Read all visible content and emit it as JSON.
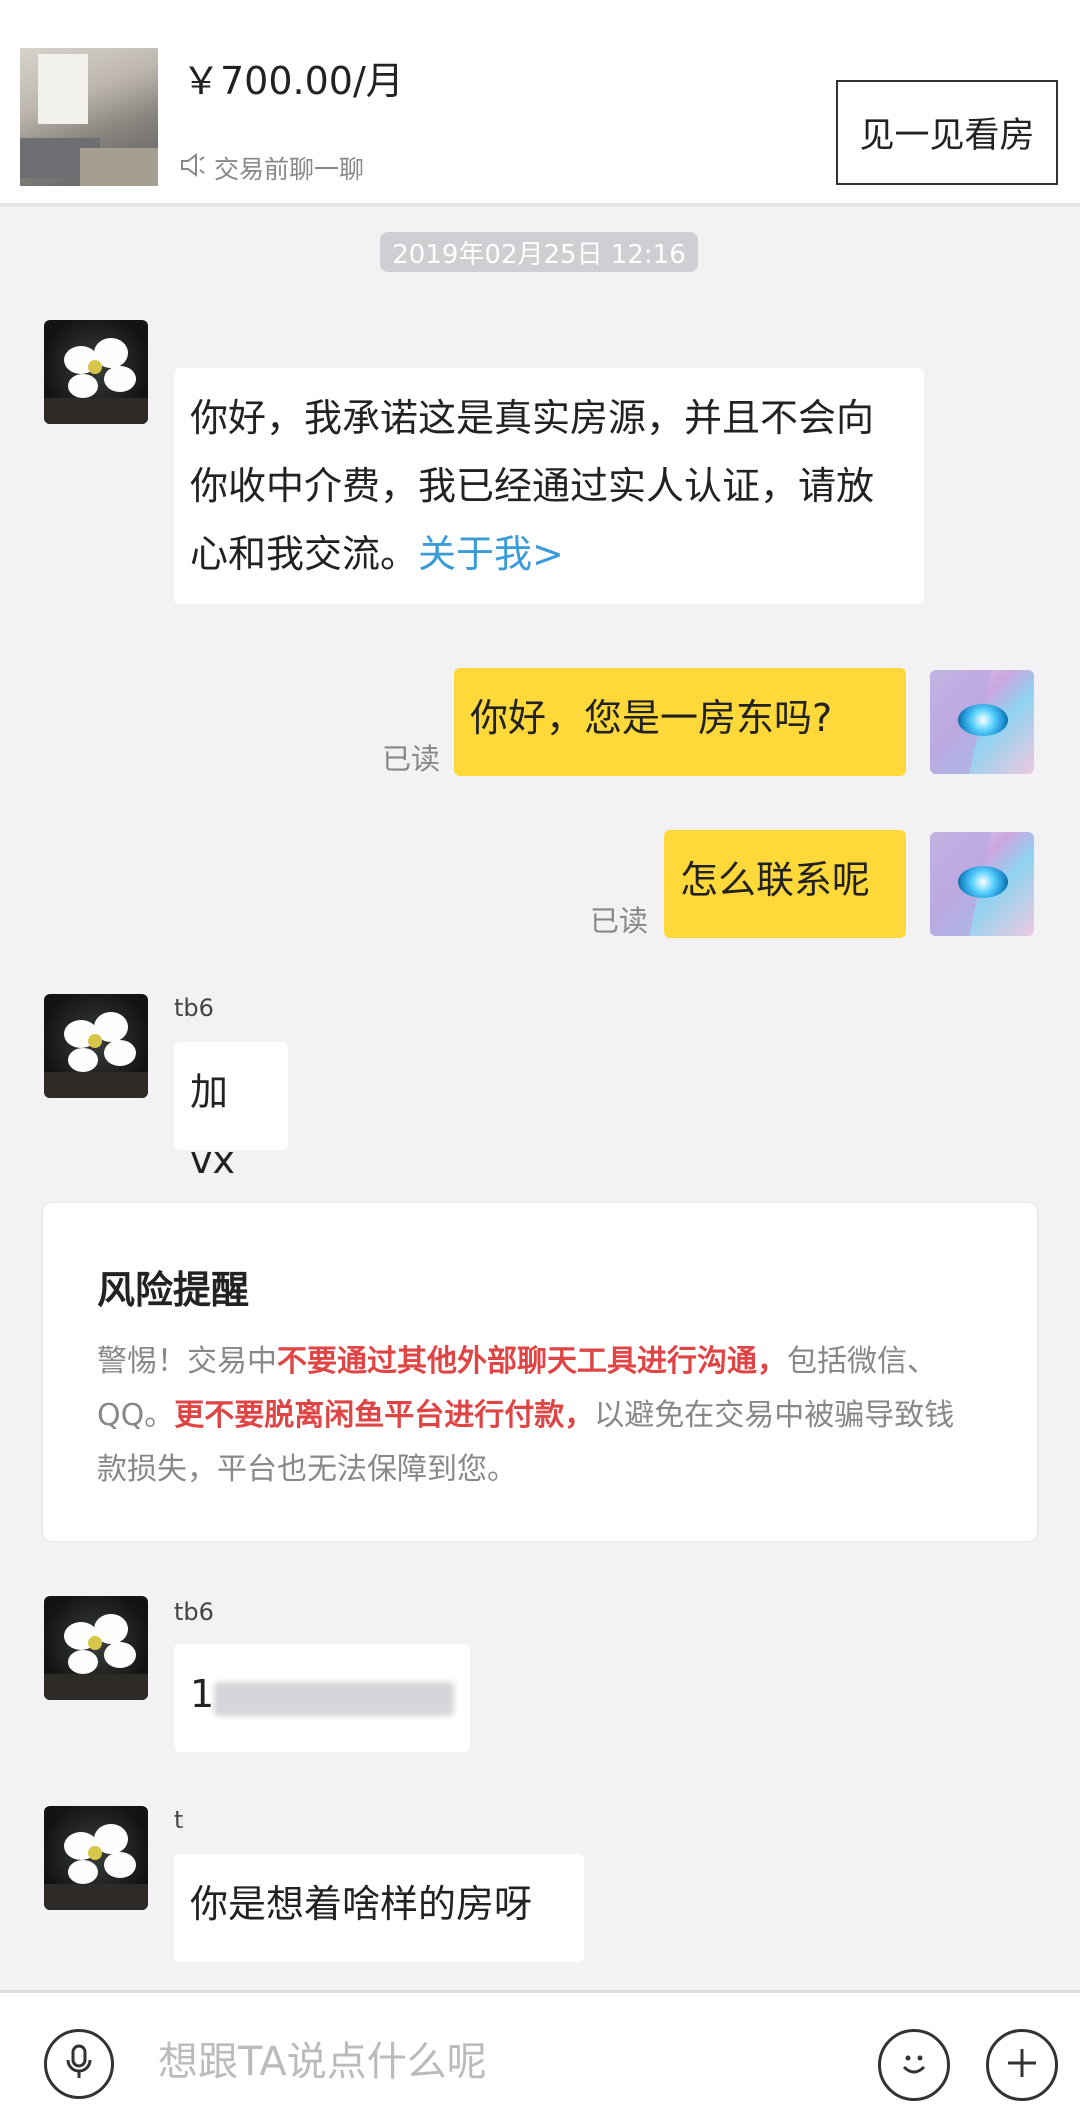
{
  "listing": {
    "price": "￥700.00/月",
    "chat_hint": "交易前聊一聊",
    "viewing_button": "见一见看房"
  },
  "timestamp": "2019年02月25日 12:16",
  "messages": [
    {
      "side": "left",
      "name": "",
      "parts": [
        "你好，我承诺这是真实房源，并且不会向你收中介费，我已经通过实人认证，请放心和我交流。",
        "关于我>"
      ]
    },
    {
      "side": "right",
      "read": "已读",
      "text": "你好，您是一房东吗?"
    },
    {
      "side": "right",
      "read": "已读",
      "text": "怎么联系呢"
    },
    {
      "side": "left",
      "name": "tb6",
      "text": "加vx"
    },
    {
      "side": "left",
      "name": "tb6",
      "text": "1"
    },
    {
      "side": "left",
      "name": "t",
      "text": "你是想着啥样的房呀"
    }
  ],
  "risk": {
    "title": "风险提醒",
    "p1": "警惕！交易中",
    "p2": "不要通过其他外部聊天工具进行沟通，",
    "p3": "包括微信、QQ。",
    "p4": "更不要脱离闲鱼平台进行付款，",
    "p5": "以避免在交易中被骗导致钱款损失，平台也无法保障到您。"
  },
  "input": {
    "placeholder": "想跟TA说点什么呢",
    "voice_icon": "microphone-icon",
    "emoji_icon": "smiley-icon",
    "plus_icon": "plus-icon"
  },
  "colors": {
    "my_bubble": "#ffd93a",
    "link": "#3a9bd9",
    "warning_red": "#e04545"
  }
}
